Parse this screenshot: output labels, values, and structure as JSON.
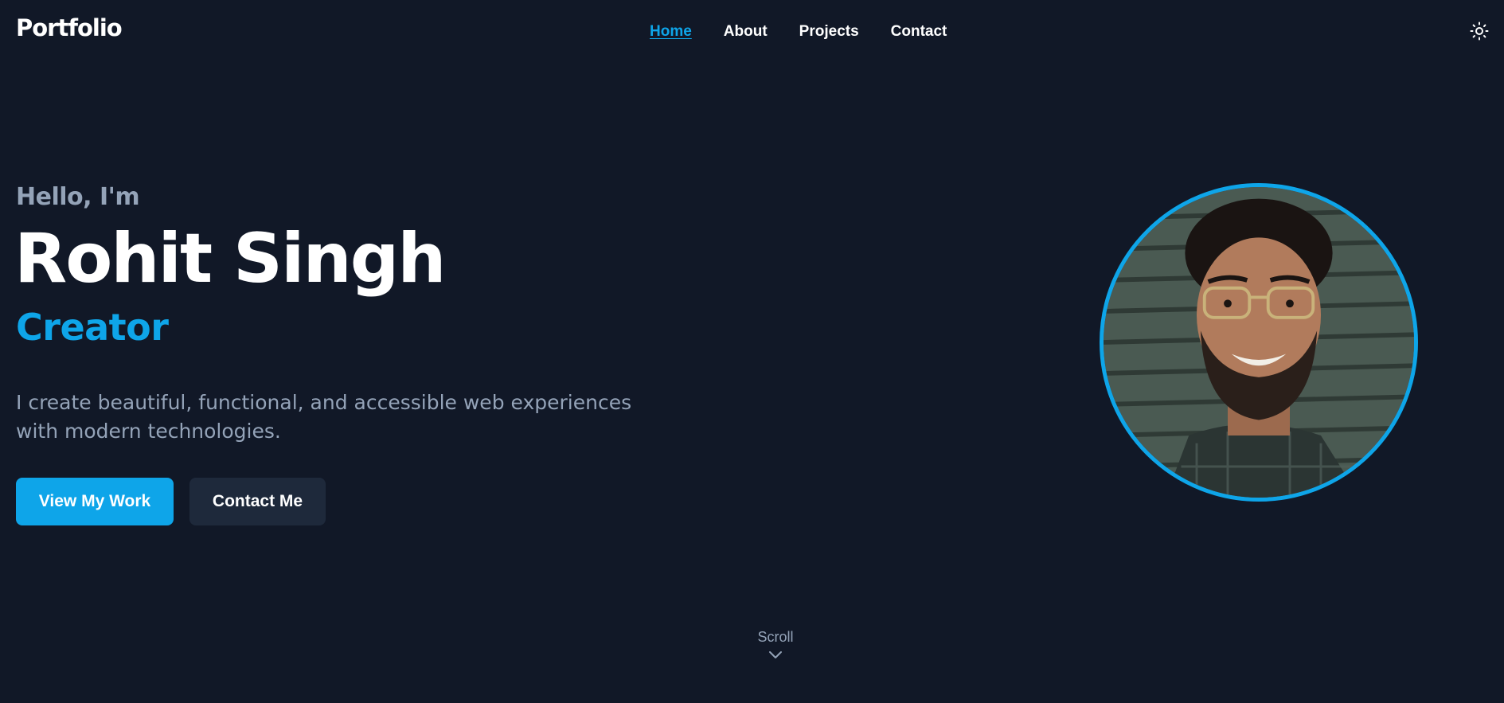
{
  "header": {
    "logo": "Portfolio",
    "nav": [
      {
        "label": "Home",
        "active": true
      },
      {
        "label": "About",
        "active": false
      },
      {
        "label": "Projects",
        "active": false
      },
      {
        "label": "Contact",
        "active": false
      }
    ],
    "theme_icon": "sun-icon"
  },
  "hero": {
    "greeting": "Hello, I'm",
    "name": "Rohit Singh",
    "role": "Creator",
    "tagline": "I create beautiful, functional, and accessible web experiences with modern technologies.",
    "primary_button": "View My Work",
    "secondary_button": "Contact Me",
    "avatar_icon": "profile-photo"
  },
  "scroll": {
    "label": "Scroll",
    "icon": "chevron-down-icon"
  },
  "colors": {
    "background": "#111827",
    "accent": "#0ea5e9",
    "muted_text": "#94a3b8",
    "secondary_button": "#1e293b"
  }
}
